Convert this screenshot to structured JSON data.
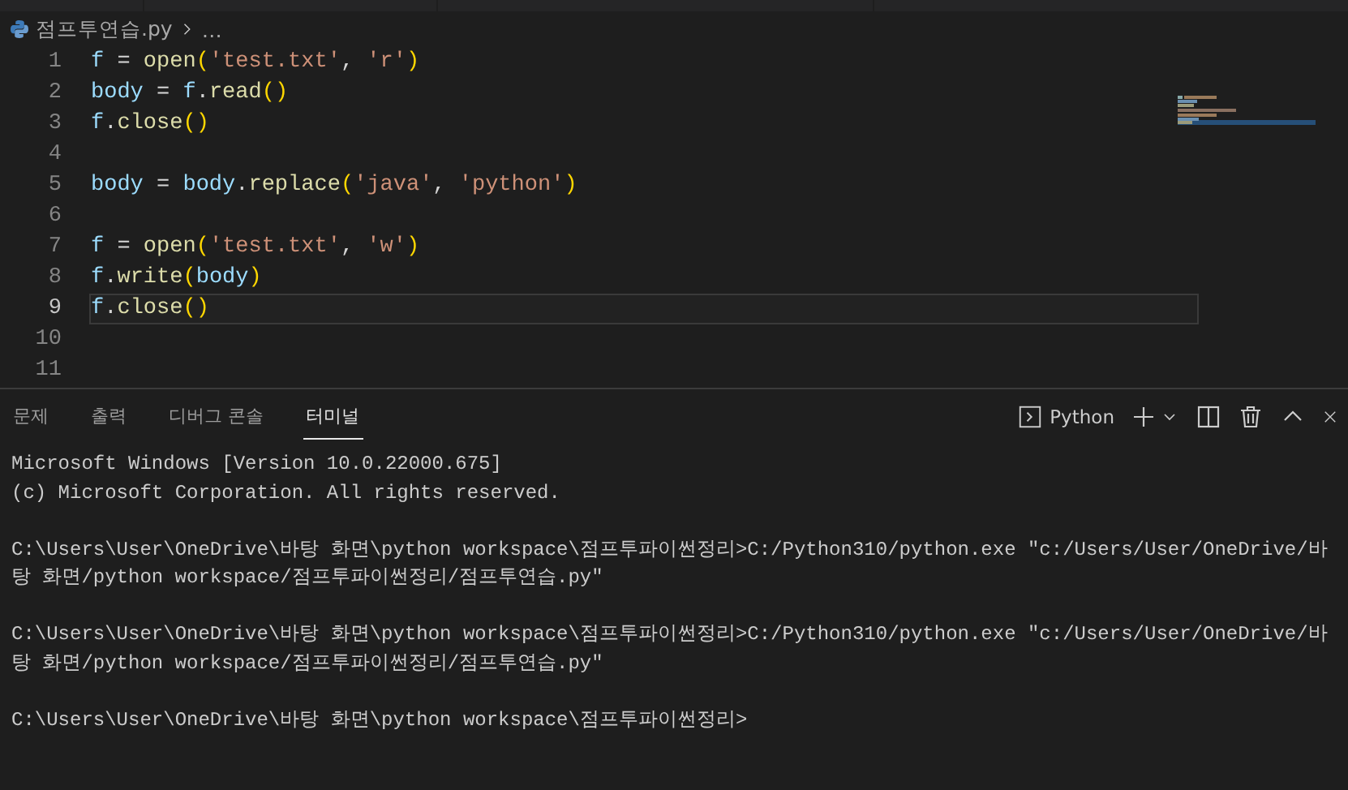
{
  "breadcrumb": {
    "file": "점프투연습.py",
    "more": "…"
  },
  "editor": {
    "lines": [
      {
        "number": "1",
        "current": false,
        "tokens": [
          {
            "kind": "var",
            "t": "f"
          },
          {
            "kind": "op",
            "t": " = "
          },
          {
            "kind": "func",
            "t": "open"
          },
          {
            "kind": "paren",
            "t": "("
          },
          {
            "kind": "str",
            "t": "'test.txt'"
          },
          {
            "kind": "op",
            "t": ", "
          },
          {
            "kind": "str",
            "t": "'r'"
          },
          {
            "kind": "paren",
            "t": ")"
          }
        ]
      },
      {
        "number": "2",
        "current": false,
        "tokens": [
          {
            "kind": "var",
            "t": "body"
          },
          {
            "kind": "op",
            "t": " = "
          },
          {
            "kind": "var",
            "t": "f"
          },
          {
            "kind": "op",
            "t": "."
          },
          {
            "kind": "func",
            "t": "read"
          },
          {
            "kind": "paren",
            "t": "()"
          }
        ]
      },
      {
        "number": "3",
        "current": false,
        "tokens": [
          {
            "kind": "var",
            "t": "f"
          },
          {
            "kind": "op",
            "t": "."
          },
          {
            "kind": "func",
            "t": "close"
          },
          {
            "kind": "paren",
            "t": "()"
          }
        ]
      },
      {
        "number": "4",
        "current": false
      },
      {
        "number": "5",
        "current": false,
        "tokens": [
          {
            "kind": "var",
            "t": "body"
          },
          {
            "kind": "op",
            "t": " = "
          },
          {
            "kind": "var",
            "t": "body"
          },
          {
            "kind": "op",
            "t": "."
          },
          {
            "kind": "func",
            "t": "replace"
          },
          {
            "kind": "paren",
            "t": "("
          },
          {
            "kind": "str",
            "t": "'java'"
          },
          {
            "kind": "op",
            "t": ", "
          },
          {
            "kind": "str",
            "t": "'python'"
          },
          {
            "kind": "paren",
            "t": ")"
          }
        ]
      },
      {
        "number": "6",
        "current": false
      },
      {
        "number": "7",
        "current": false,
        "tokens": [
          {
            "kind": "var",
            "t": "f"
          },
          {
            "kind": "op",
            "t": " = "
          },
          {
            "kind": "func",
            "t": "open"
          },
          {
            "kind": "paren",
            "t": "("
          },
          {
            "kind": "str",
            "t": "'test.txt'"
          },
          {
            "kind": "op",
            "t": ", "
          },
          {
            "kind": "str",
            "t": "'w'"
          },
          {
            "kind": "paren",
            "t": ")"
          }
        ]
      },
      {
        "number": "8",
        "current": false,
        "tokens": [
          {
            "kind": "var",
            "t": "f"
          },
          {
            "kind": "op",
            "t": "."
          },
          {
            "kind": "func",
            "t": "write"
          },
          {
            "kind": "paren",
            "t": "("
          },
          {
            "kind": "var",
            "t": "body"
          },
          {
            "kind": "paren",
            "t": ")"
          }
        ]
      },
      {
        "number": "9",
        "current": true,
        "tokens": [
          {
            "kind": "var",
            "t": "f"
          },
          {
            "kind": "op",
            "t": "."
          },
          {
            "kind": "func",
            "t": "close"
          },
          {
            "kind": "paren",
            "t": "()"
          }
        ]
      },
      {
        "number": "10",
        "current": false
      },
      {
        "number": "11",
        "current": false
      }
    ]
  },
  "panel": {
    "tabs": [
      {
        "label": "문제",
        "selected": false
      },
      {
        "label": "출력",
        "selected": false
      },
      {
        "label": "디버그 콘솔",
        "selected": false
      },
      {
        "label": "터미널",
        "selected": true
      }
    ],
    "terminal_name": "Python",
    "terminal": [
      [
        "Microsoft Windows [Version 10.0.22000.675]",
        "(c) Microsoft Corporation. All rights reserved."
      ],
      [
        "C:\\Users\\User\\OneDrive\\바탕 화면\\python workspace\\점프투파이썬정리>C:/Python310/python.exe \"c:/Users/User/OneDrive/바",
        "탕 화면/python workspace/점프투파이썬정리/점프투연습.py\""
      ],
      [
        "C:\\Users\\User\\OneDrive\\바탕 화면\\python workspace\\점프투파이썬정리>C:/Python310/python.exe \"c:/Users/User/OneDrive/바",
        "탕 화면/python workspace/점프투파이썬정리/점프투연습.py\""
      ],
      [
        "C:\\Users\\User\\OneDrive\\바탕 화면\\python workspace\\점프투파이썬정리>"
      ]
    ]
  }
}
